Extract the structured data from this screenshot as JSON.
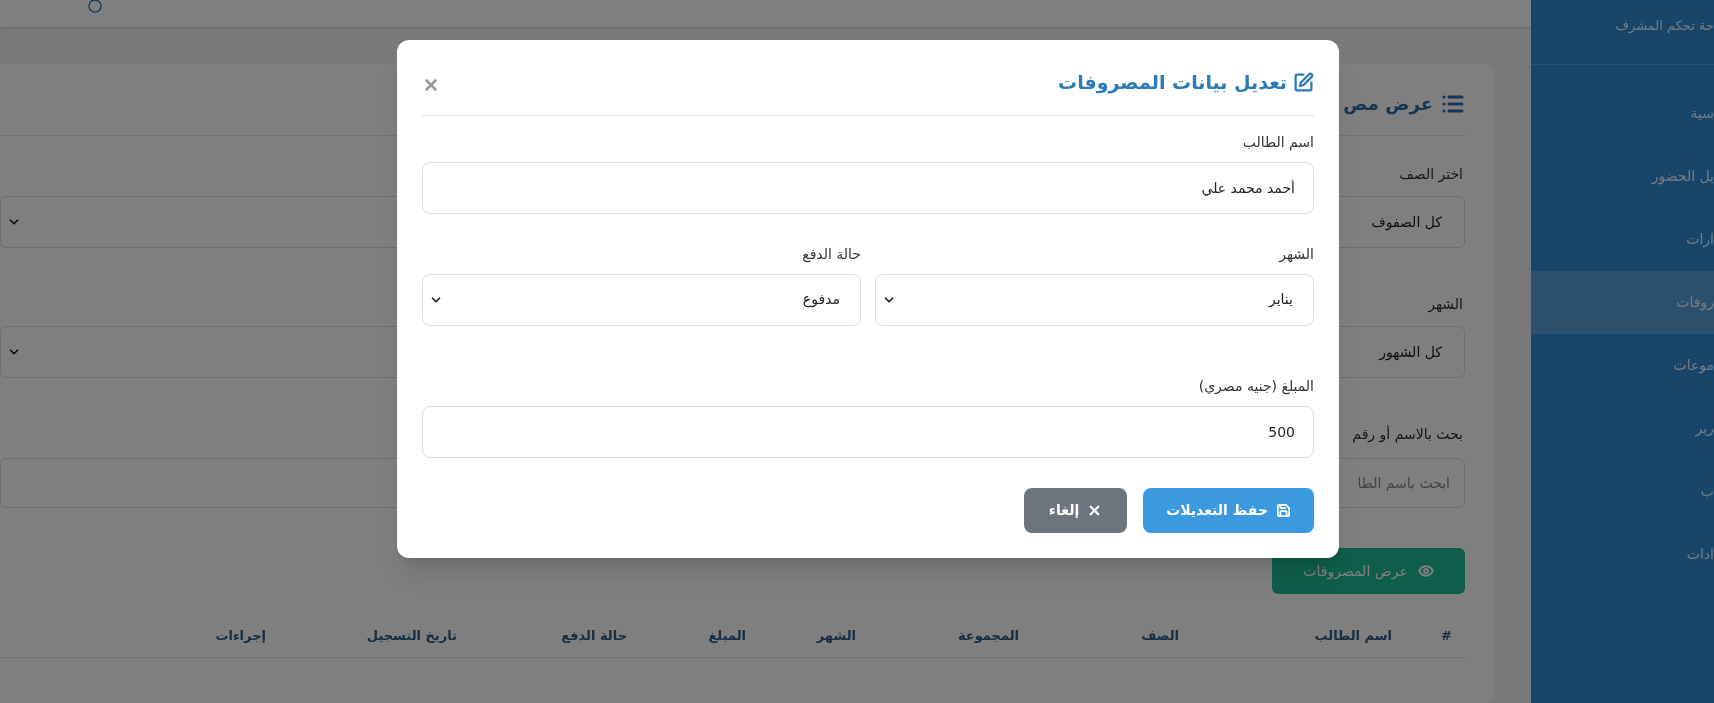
{
  "sidebar": {
    "subtitle": "حة تحكم المشرف",
    "items": [
      {
        "label": "سية",
        "selected": false
      },
      {
        "label": "يل الحضور",
        "selected": false
      },
      {
        "label": "ارات",
        "selected": false
      },
      {
        "label": "روفات",
        "selected": true
      },
      {
        "label": "موعات",
        "selected": false
      },
      {
        "label": "رير",
        "selected": false
      },
      {
        "label": "ب",
        "selected": false
      },
      {
        "label": "ادات",
        "selected": false
      }
    ]
  },
  "page": {
    "title": "عرض مص",
    "filters": [
      {
        "kind": "select",
        "label": "اختر الصف",
        "value": "كل الصفوف"
      },
      {
        "kind": "select",
        "label": "الشهر",
        "value": "كل الشهور"
      },
      {
        "kind": "search",
        "label": "بحث بالاسم أو رقم",
        "placeholder": "ابحث باسم الطا"
      }
    ],
    "show_button": "عرض المصروفات",
    "table": {
      "columns": [
        "#",
        "اسم الطالب",
        "الصف",
        "المجموعة",
        "الشهر",
        "المبلغ",
        "حالة الدفع",
        "تاريخ التسجيل",
        "إجراءات"
      ]
    }
  },
  "modal": {
    "title": "تعديل بيانات المصروفات",
    "rows": [
      [
        {
          "kind": "input",
          "label": "اسم الطالب",
          "value": "أحمد محمد علي"
        }
      ],
      [
        {
          "kind": "select",
          "label": "الشهر",
          "value": "يناير"
        },
        {
          "kind": "select",
          "label": "حالة الدفع",
          "value": "مدفوع"
        }
      ],
      [
        {
          "kind": "input",
          "label": "المبلغ (جنيه مصري)",
          "value": "500"
        }
      ]
    ],
    "buttons": [
      {
        "kind": "save",
        "label": "حفظ التعديلات"
      },
      {
        "kind": "cancel",
        "label": "إلغاء"
      }
    ]
  }
}
